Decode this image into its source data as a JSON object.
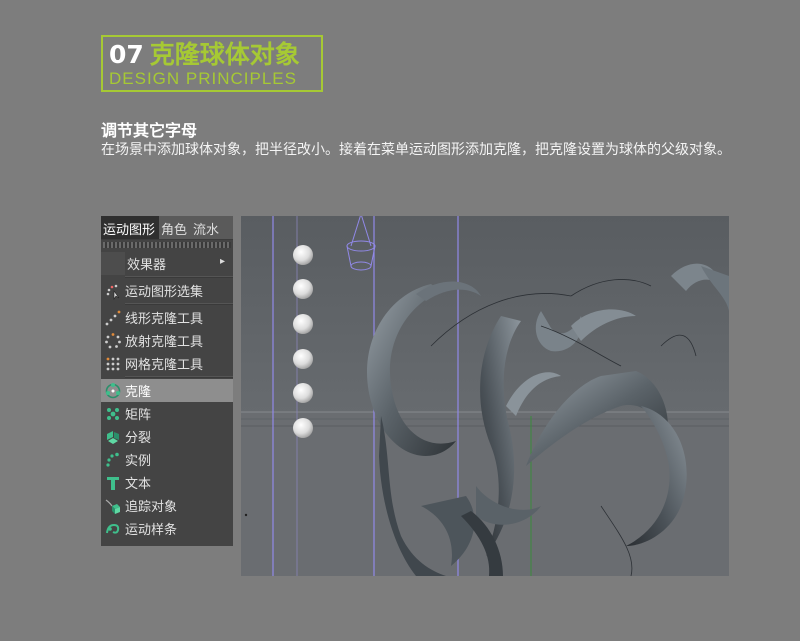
{
  "header": {
    "number": "07",
    "title_cn": "克隆球体对象",
    "subtitle": "DESIGN PRINCIPLES"
  },
  "section": {
    "heading": "调节其它字母",
    "body": "在场景中添加球体对象，把半径改小。接着在菜单运动图形添加克隆，把克隆设置为球体的父级对象。"
  },
  "menubar": {
    "items": [
      "运动图形",
      "角色",
      "流水"
    ]
  },
  "menu": {
    "items": [
      {
        "label": "效果器",
        "icon": "blank",
        "has_submenu": true
      },
      {
        "label": "运动图形选集",
        "icon": "mograph-selection-icon"
      },
      {
        "label": "线形克隆工具",
        "icon": "linear-clone-icon"
      },
      {
        "label": "放射克隆工具",
        "icon": "radial-clone-icon"
      },
      {
        "label": "网格克隆工具",
        "icon": "grid-clone-icon"
      },
      {
        "label": "克隆",
        "icon": "cloner-icon",
        "selected": true
      },
      {
        "label": "矩阵",
        "icon": "matrix-icon"
      },
      {
        "label": "分裂",
        "icon": "fracture-icon"
      },
      {
        "label": "实例",
        "icon": "instance-icon"
      },
      {
        "label": "文本",
        "icon": "text-icon"
      },
      {
        "label": "追踪对象",
        "icon": "tracer-icon"
      },
      {
        "label": "运动样条",
        "icon": "mospline-icon"
      }
    ]
  },
  "colors": {
    "accent": "#a6c934",
    "background": "#7d7d7d",
    "menu_bg": "#444444",
    "selected_bg": "#8e8e8e",
    "viewport_bg": "#5e6266",
    "guide_line": "#8f86e0"
  }
}
